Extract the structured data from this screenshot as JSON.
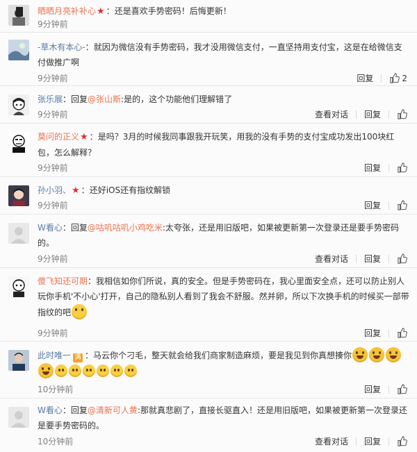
{
  "comments": [
    {
      "id": "c1",
      "user": "晒晒月亮补补心",
      "separator": "：",
      "text": "还是喜欢手势密码！后悔更新！",
      "time": "9分钟前"
    },
    {
      "id": "c2",
      "user": "-草木有本心-",
      "separator": "：",
      "text": "就因为微信没有手势密码，我才没用微信支付，一直坚持用支付宝，这是在给微信支付做推广啊",
      "time": "9分钟前",
      "reply_label": "回复",
      "like_count": "2"
    },
    {
      "id": "c3",
      "user": "张乐展",
      "separator": "：",
      "reply_prefix": "回复",
      "mention": "@张山斯",
      "text": ":是的，这个功能他们理解错了",
      "time": "9分钟前",
      "view_dialog_label": "查看对话",
      "reply_label": "回复"
    },
    {
      "id": "c4",
      "user": "莫问的正义",
      "separator": "：",
      "text": "是吗？3月的时候我同事跟我开玩笑，用我的没有手势的支付宝成功发出100块红包，怎么解释？",
      "time": "9分钟前",
      "reply_label": "回复"
    },
    {
      "id": "c5",
      "user": "孙小羽、",
      "separator": "：",
      "text": "还好iOS还有指纹解锁",
      "time": "9分钟前",
      "reply_label": "回复"
    },
    {
      "id": "c6",
      "user": "W看心",
      "separator": "：",
      "reply_prefix": "回复",
      "mention": "@咕叽咕叽小鸡吃米",
      "text": ":太夸张，还是用旧版吧，如果被更新第一次登录还是要手势密码的。",
      "time": "9分钟前",
      "view_dialog_label": "查看对话",
      "reply_label": "回复"
    },
    {
      "id": "c7",
      "user": "傻飞知还可期",
      "separator": "：",
      "text": "我相信如你们所说，真的安全。但是手势密码在，我心里面安全点，还可以防止别人玩你手机'不小心'打开，自己的隐私别人看到了我会不舒服。然并卵，所以下次换手机的时候买一部带指纹的吧",
      "time": "9分钟前",
      "reply_label": "回复"
    },
    {
      "id": "c8",
      "user": "此时唯一",
      "badge": "🈵",
      "separator": "：",
      "text": "马云你个刁毛，整天就会给我们商家制造麻烦，要是我见到你真想揍你",
      "time": "10分钟前",
      "reply_label": "回复"
    },
    {
      "id": "c9",
      "user": "W看心",
      "separator": "：",
      "reply_prefix": "回复",
      "mention": "@清新可人黄",
      "text": ":那就真悲剧了，直接长驱直入！还是用旧版吧，如果被更新第一次登录还是要手势密码的。",
      "time": "10分钟前",
      "view_dialog_label": "查看对话",
      "reply_label": "回复"
    }
  ],
  "colors": {
    "username": "#eb7350",
    "username_blue": "#5b7ba8",
    "text": "#333333",
    "time": "#808080",
    "divider": "#e6e6e6",
    "star": "#e0302c"
  }
}
